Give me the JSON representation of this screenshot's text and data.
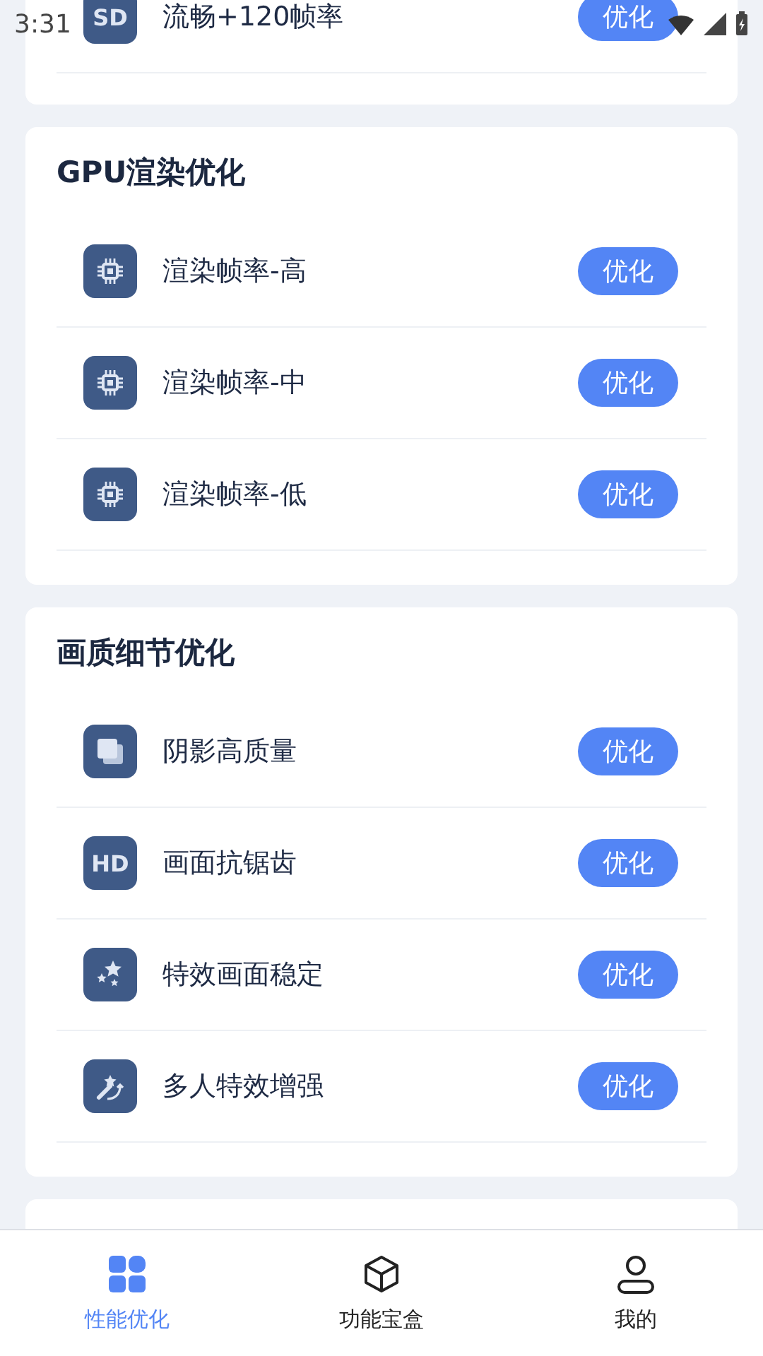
{
  "status_bar": {
    "time": "3:31"
  },
  "sections": [
    {
      "items": [
        {
          "kind": "sd",
          "icon_text": "SD",
          "label": "流畅+120帧率",
          "button": "优化"
        }
      ]
    },
    {
      "title": "GPU渲染优化",
      "items": [
        {
          "kind": "chip",
          "label": "渲染帧率-高",
          "button": "优化"
        },
        {
          "kind": "chip",
          "label": "渲染帧率-中",
          "button": "优化"
        },
        {
          "kind": "chip",
          "label": "渲染帧率-低",
          "button": "优化"
        }
      ]
    },
    {
      "title": "画质细节优化",
      "items": [
        {
          "kind": "shadow",
          "label": "阴影高质量",
          "button": "优化"
        },
        {
          "kind": "hd",
          "icon_text": "HD",
          "label": "画面抗锯齿",
          "button": "优化"
        },
        {
          "kind": "stars",
          "label": "特效画面稳定",
          "button": "优化"
        },
        {
          "kind": "wand",
          "label": "多人特效增强",
          "button": "优化"
        }
      ]
    }
  ],
  "bottom_nav": [
    {
      "kind": "grid",
      "label": "性能优化",
      "selected": true
    },
    {
      "kind": "cube",
      "label": "功能宝盒",
      "selected": false
    },
    {
      "kind": "person",
      "label": "我的",
      "selected": false
    }
  ]
}
